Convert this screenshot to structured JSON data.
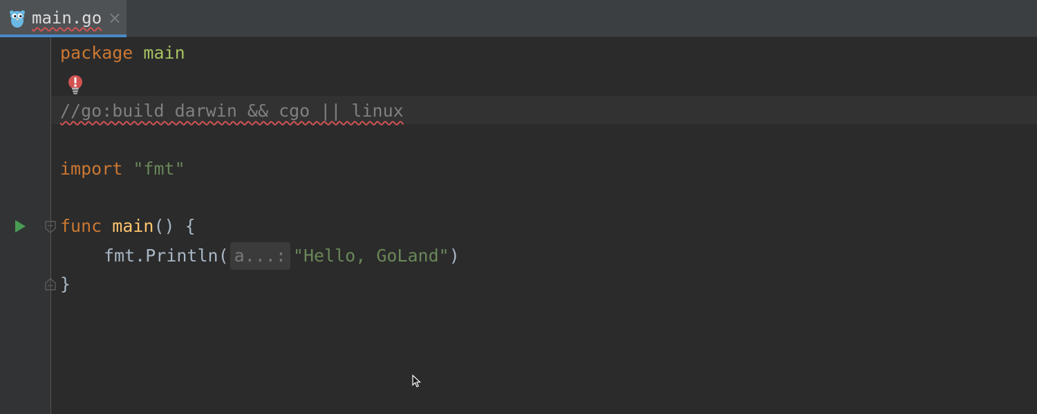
{
  "tabs": [
    {
      "label": "main.go",
      "icon": "gopher-icon",
      "close_glyph": "×"
    }
  ],
  "code": {
    "line1": {
      "keyword": "package",
      "name": "main"
    },
    "line3": {
      "comment": "//go:build darwin && cgo || linux"
    },
    "line5": {
      "keyword": "import",
      "string": "\"fmt\""
    },
    "line7": {
      "keyword": "func",
      "name": "main",
      "rest": "() {"
    },
    "line8": {
      "pkg": "fmt",
      "dot": ".",
      "call": "Println",
      "open": "(",
      "hint": "a...:",
      "string": "\"Hello, GoLand\"",
      "close": ")"
    },
    "line9": {
      "brace": "}"
    }
  },
  "colors": {
    "keyword": "#cc7832",
    "string": "#6a8759",
    "comment": "#808080",
    "error": "#d25252",
    "run": "#499c54"
  }
}
